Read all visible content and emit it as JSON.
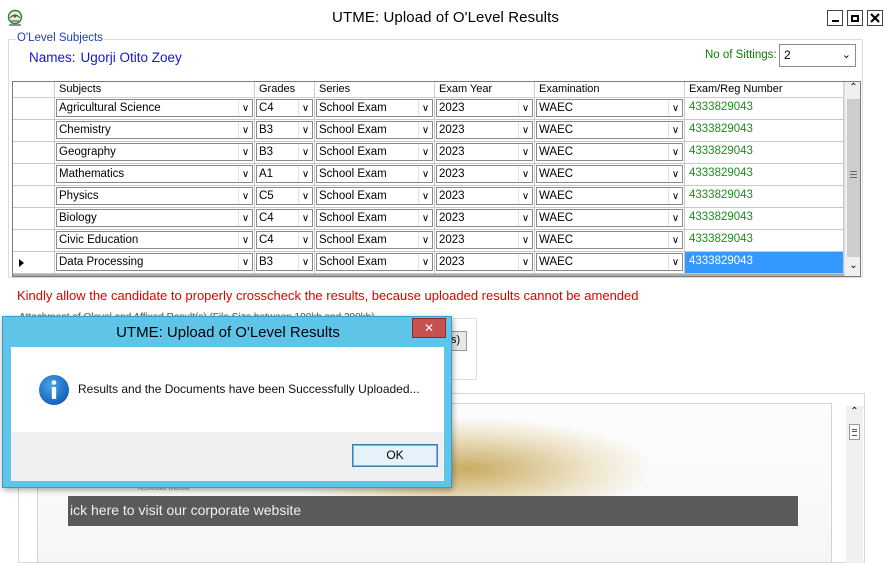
{
  "window": {
    "title": "UTME: Upload of O'Level Results",
    "controls": {
      "minimize_icon": "minimize-icon",
      "maximize_icon": "maximize-icon",
      "close_icon": "close-icon"
    }
  },
  "group": {
    "legend": "O'Level Subjects",
    "names_label": "Names:",
    "candidate_name": "Ugorji Otito Zoey",
    "sittings_label": "No of Sittings:",
    "sittings_value": "2"
  },
  "grid": {
    "columns": [
      "Subjects",
      "Grades",
      "Series",
      "Exam Year",
      "Examination",
      "Exam/Reg Number"
    ],
    "rows": [
      {
        "subject": "Agricultural Science",
        "grade": "C4",
        "series": "School Exam",
        "year": "2023",
        "exam": "WAEC",
        "reg": "4333829043"
      },
      {
        "subject": "Chemistry",
        "grade": "B3",
        "series": "School Exam",
        "year": "2023",
        "exam": "WAEC",
        "reg": "4333829043"
      },
      {
        "subject": "Geography",
        "grade": "B3",
        "series": "School Exam",
        "year": "2023",
        "exam": "WAEC",
        "reg": "4333829043"
      },
      {
        "subject": "Mathematics",
        "grade": "A1",
        "series": "School Exam",
        "year": "2023",
        "exam": "WAEC",
        "reg": "4333829043"
      },
      {
        "subject": "Physics",
        "grade": "C5",
        "series": "School Exam",
        "year": "2023",
        "exam": "WAEC",
        "reg": "4333829043"
      },
      {
        "subject": "Biology",
        "grade": "C4",
        "series": "School Exam",
        "year": "2023",
        "exam": "WAEC",
        "reg": "4333829043"
      },
      {
        "subject": "Civic Education",
        "grade": "C4",
        "series": "School Exam",
        "year": "2023",
        "exam": "WAEC",
        "reg": "4333829043"
      },
      {
        "subject": "Data Processing",
        "grade": "B3",
        "series": "School Exam",
        "year": "2023",
        "exam": "WAEC",
        "reg": "4333829043",
        "current": true,
        "selected": true
      }
    ]
  },
  "warning": "Kindly allow the candidate to properly crosscheck the results, because uploaded results cannot be amended",
  "background": {
    "attach_label": "Attachment of Olevel and Affixed Result(s) (File Size between 100kb and 200kb)",
    "browse_label": "s)"
  },
  "web_view": {
    "banner_text": "ick here to visit our corporate website",
    "small_text": "Accredited Website"
  },
  "dialog": {
    "title": "UTME: Upload of O'Level Results",
    "message": "Results and the Documents have been Successfully Uploaded...",
    "ok_label": "OK",
    "icon": "info-icon",
    "close_glyph": "✕"
  },
  "colors": {
    "accent_blue": "#3399ff",
    "reg_number_green": "#1f8a1f",
    "warning_red": "#e00000",
    "dialog_frame": "#5ec5e8",
    "dialog_close": "#c75050"
  }
}
